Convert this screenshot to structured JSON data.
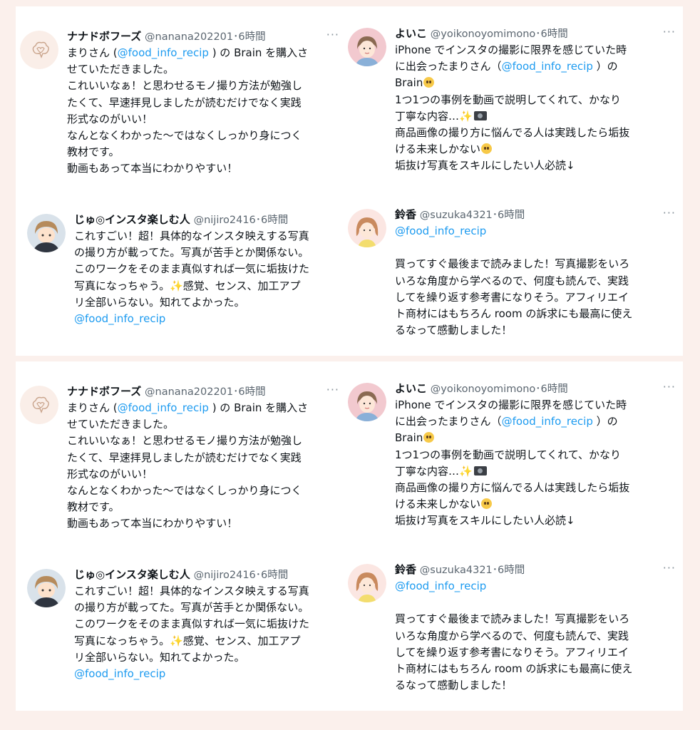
{
  "tweets": {
    "nanana": {
      "name": "ナナドボフーズ",
      "meta": "@nanana202201･6時間",
      "more": "···",
      "lines": [
        [
          "まりさん (",
          "@food_info_recip",
          " ) の Brain を購入さ"
        ],
        "せていただきました。",
        "これいいなぁ！と思わせるモノ撮り方法が勉強し",
        "たくて、早速拝見しましたが読むだけでなく実践",
        "形式なのがいい！",
        "なんとなくわかった〜ではなくしっかり身につく",
        "教材です。",
        "動画もあって本当にわかりやすい！"
      ]
    },
    "yoiko": {
      "name": "よいこ",
      "meta": "@yoikonoyomimono･6時間",
      "more": "···",
      "lines": [
        "iPhone でインスタの撮影に限界を感じていた時",
        [
          "に出会ったまりさん（",
          "@food_info_recip",
          " ）の"
        ],
        "Brain",
        "1つ1つの事例を動画で説明してくれて、かなり",
        "丁寧な内容…",
        "商品画像の撮り方に悩んでる人は実践したら垢抜",
        "ける未来しかない",
        "垢抜け写真をスキルにしたい人必読↓"
      ]
    },
    "nijiro": {
      "name": "じゅ◎インスタ楽しむ人",
      "meta": "@nijiro2416･6時間",
      "lines": [
        "これすごい！超！具体的なインスタ映えする写真",
        "の撮り方が載ってた。写真が苦手とか関係ない。",
        "このワークをそのまま真似すれば一気に垢抜けた",
        "写真になっちゃう。",
        "感覚、センス、加工アプ",
        "リ全部いらない。知れてよかった。",
        "@food_info_recip"
      ]
    },
    "suzuka": {
      "name": "鈴香",
      "meta": "@suzuka4321･6時間",
      "more": "···",
      "lines": [
        "@food_info_recip",
        "買ってすぐ最後まで読みました！写真撮影をいろ",
        "いろな角度から学べるので、何度も読んで、実践",
        "してを繰り返す参考書になりそう。アフィリエイ",
        "ト商材にはもちろん room の訴求にも最高に使え",
        "るなって感動しました！"
      ]
    }
  },
  "emoji": {
    "sparkles": "✨"
  },
  "colors": {
    "link": "#1d9bf0",
    "background": "#fbf0ec",
    "card": "#ffffff"
  }
}
